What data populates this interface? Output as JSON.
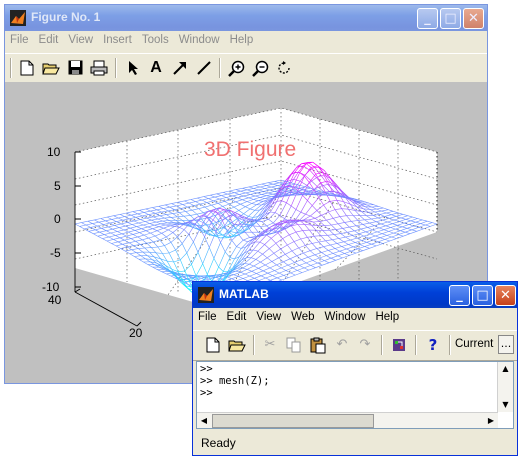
{
  "figure_window": {
    "title": "Figure No. 1",
    "menu": [
      "File",
      "Edit",
      "View",
      "Insert",
      "Tools",
      "Window",
      "Help"
    ],
    "toolbar_icons": [
      "new-icon",
      "open-icon",
      "save-icon",
      "print-icon",
      "select-arrow-icon",
      "text-icon",
      "arrow-icon",
      "line-icon",
      "zoom-in-icon",
      "zoom-out-icon",
      "rotate-icon"
    ],
    "plot": {
      "title": "3D Figure",
      "title_color": "#f07070",
      "z_ticks": [
        "10",
        "5",
        "0",
        "-5",
        "-10"
      ],
      "y_ticks": [
        "40",
        "20"
      ],
      "colors": {
        "high": "#ff00ff",
        "low": "#00ffff",
        "background": "#c0c0c0"
      }
    }
  },
  "matlab_window": {
    "title": "MATLAB",
    "menu": [
      "File",
      "Edit",
      "View",
      "Web",
      "Window",
      "Help"
    ],
    "toolbar_icons": [
      "new-icon",
      "open-icon",
      "cut-icon",
      "copy-icon",
      "paste-icon",
      "undo-icon",
      "redo-icon",
      "simulink-icon",
      "help-icon"
    ],
    "current_dir_label": "Current",
    "more_button": "...",
    "command_lines": [
      ">>",
      ">> mesh(Z);",
      ">>"
    ],
    "status": "Ready"
  }
}
